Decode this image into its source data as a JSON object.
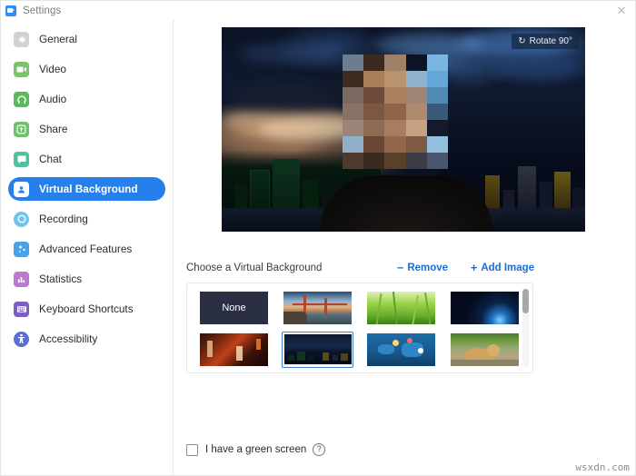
{
  "window": {
    "title": "Settings",
    "logo_icon": "zoom-logo-icon",
    "close_icon": "✕"
  },
  "sidebar": {
    "items": [
      {
        "label": "General",
        "icon": "gear-icon",
        "color": "#c9c9c9",
        "active": false
      },
      {
        "label": "Video",
        "icon": "camera-icon",
        "color": "#7ac36a",
        "active": false
      },
      {
        "label": "Audio",
        "icon": "headphone-icon",
        "color": "#5cb85c",
        "active": false
      },
      {
        "label": "Share",
        "icon": "share-up-icon",
        "color": "#6fc06f",
        "active": false
      },
      {
        "label": "Chat",
        "icon": "chat-bubble-icon",
        "color": "#4fc3a1",
        "active": false
      },
      {
        "label": "Virtual Background",
        "icon": "person-card-icon",
        "color": "#2680eb",
        "active": true
      },
      {
        "label": "Recording",
        "icon": "record-circle-icon",
        "color": "#6ec6f0",
        "active": false
      },
      {
        "label": "Advanced Features",
        "icon": "sparkle-icon",
        "color": "#4aa3e8",
        "active": false
      },
      {
        "label": "Statistics",
        "icon": "bar-chart-icon",
        "color": "#b97ad1",
        "active": false
      },
      {
        "label": "Keyboard Shortcuts",
        "icon": "keyboard-icon",
        "color": "#7a5fc0",
        "active": false
      },
      {
        "label": "Accessibility",
        "icon": "accessibility-icon",
        "color": "#5a6fd4",
        "active": false
      }
    ]
  },
  "preview": {
    "rotate_label": "Rotate 90°",
    "rotate_icon": "rotate-icon"
  },
  "chooser": {
    "title": "Choose a Virtual Background",
    "remove_label": "Remove",
    "remove_sign": "−",
    "add_label": "Add Image",
    "add_sign": "+",
    "none_label": "None",
    "thumbnails": [
      {
        "name": "none",
        "selected": false
      },
      {
        "name": "golden-gate",
        "selected": false
      },
      {
        "name": "grass",
        "selected": false
      },
      {
        "name": "earth-space",
        "selected": false
      },
      {
        "name": "night-street",
        "selected": false
      },
      {
        "name": "city-skyline",
        "selected": true
      },
      {
        "name": "world-network",
        "selected": false
      },
      {
        "name": "dog-park",
        "selected": false
      }
    ]
  },
  "green_screen": {
    "label": "I have a green screen",
    "checked": false,
    "help_icon": "?"
  },
  "watermark": {
    "text": "wsxdn.com"
  },
  "colors": {
    "accent": "#2680eb",
    "link": "#1a6fd4",
    "sidebar_border": "#ececec",
    "selected_thumb_border": "#3f7dc4"
  }
}
